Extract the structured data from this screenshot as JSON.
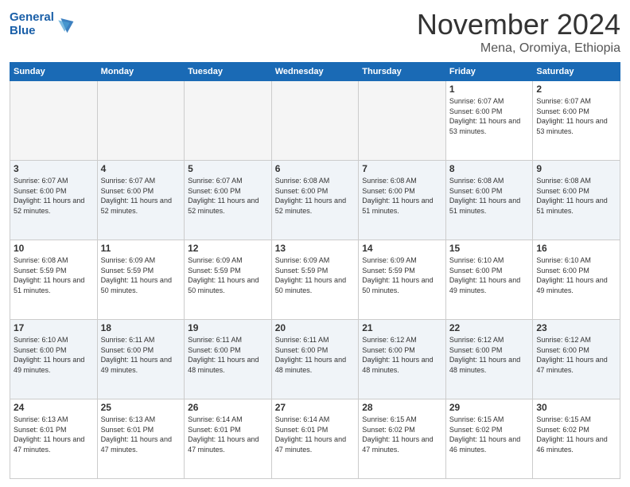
{
  "logo": {
    "line1": "General",
    "line2": "Blue"
  },
  "title": "November 2024",
  "location": "Mena, Oromiya, Ethiopia",
  "weekdays": [
    "Sunday",
    "Monday",
    "Tuesday",
    "Wednesday",
    "Thursday",
    "Friday",
    "Saturday"
  ],
  "weeks": [
    [
      {
        "day": "",
        "empty": true
      },
      {
        "day": "",
        "empty": true
      },
      {
        "day": "",
        "empty": true
      },
      {
        "day": "",
        "empty": true
      },
      {
        "day": "",
        "empty": true
      },
      {
        "day": "1",
        "sunrise": "6:07 AM",
        "sunset": "6:00 PM",
        "daylight": "11 hours and 53 minutes."
      },
      {
        "day": "2",
        "sunrise": "6:07 AM",
        "sunset": "6:00 PM",
        "daylight": "11 hours and 53 minutes."
      }
    ],
    [
      {
        "day": "3",
        "sunrise": "6:07 AM",
        "sunset": "6:00 PM",
        "daylight": "11 hours and 52 minutes."
      },
      {
        "day": "4",
        "sunrise": "6:07 AM",
        "sunset": "6:00 PM",
        "daylight": "11 hours and 52 minutes."
      },
      {
        "day": "5",
        "sunrise": "6:07 AM",
        "sunset": "6:00 PM",
        "daylight": "11 hours and 52 minutes."
      },
      {
        "day": "6",
        "sunrise": "6:08 AM",
        "sunset": "6:00 PM",
        "daylight": "11 hours and 52 minutes."
      },
      {
        "day": "7",
        "sunrise": "6:08 AM",
        "sunset": "6:00 PM",
        "daylight": "11 hours and 51 minutes."
      },
      {
        "day": "8",
        "sunrise": "6:08 AM",
        "sunset": "6:00 PM",
        "daylight": "11 hours and 51 minutes."
      },
      {
        "day": "9",
        "sunrise": "6:08 AM",
        "sunset": "6:00 PM",
        "daylight": "11 hours and 51 minutes."
      }
    ],
    [
      {
        "day": "10",
        "sunrise": "6:08 AM",
        "sunset": "5:59 PM",
        "daylight": "11 hours and 51 minutes."
      },
      {
        "day": "11",
        "sunrise": "6:09 AM",
        "sunset": "5:59 PM",
        "daylight": "11 hours and 50 minutes."
      },
      {
        "day": "12",
        "sunrise": "6:09 AM",
        "sunset": "5:59 PM",
        "daylight": "11 hours and 50 minutes."
      },
      {
        "day": "13",
        "sunrise": "6:09 AM",
        "sunset": "5:59 PM",
        "daylight": "11 hours and 50 minutes."
      },
      {
        "day": "14",
        "sunrise": "6:09 AM",
        "sunset": "5:59 PM",
        "daylight": "11 hours and 50 minutes."
      },
      {
        "day": "15",
        "sunrise": "6:10 AM",
        "sunset": "6:00 PM",
        "daylight": "11 hours and 49 minutes."
      },
      {
        "day": "16",
        "sunrise": "6:10 AM",
        "sunset": "6:00 PM",
        "daylight": "11 hours and 49 minutes."
      }
    ],
    [
      {
        "day": "17",
        "sunrise": "6:10 AM",
        "sunset": "6:00 PM",
        "daylight": "11 hours and 49 minutes."
      },
      {
        "day": "18",
        "sunrise": "6:11 AM",
        "sunset": "6:00 PM",
        "daylight": "11 hours and 49 minutes."
      },
      {
        "day": "19",
        "sunrise": "6:11 AM",
        "sunset": "6:00 PM",
        "daylight": "11 hours and 48 minutes."
      },
      {
        "day": "20",
        "sunrise": "6:11 AM",
        "sunset": "6:00 PM",
        "daylight": "11 hours and 48 minutes."
      },
      {
        "day": "21",
        "sunrise": "6:12 AM",
        "sunset": "6:00 PM",
        "daylight": "11 hours and 48 minutes."
      },
      {
        "day": "22",
        "sunrise": "6:12 AM",
        "sunset": "6:00 PM",
        "daylight": "11 hours and 48 minutes."
      },
      {
        "day": "23",
        "sunrise": "6:12 AM",
        "sunset": "6:00 PM",
        "daylight": "11 hours and 47 minutes."
      }
    ],
    [
      {
        "day": "24",
        "sunrise": "6:13 AM",
        "sunset": "6:01 PM",
        "daylight": "11 hours and 47 minutes."
      },
      {
        "day": "25",
        "sunrise": "6:13 AM",
        "sunset": "6:01 PM",
        "daylight": "11 hours and 47 minutes."
      },
      {
        "day": "26",
        "sunrise": "6:14 AM",
        "sunset": "6:01 PM",
        "daylight": "11 hours and 47 minutes."
      },
      {
        "day": "27",
        "sunrise": "6:14 AM",
        "sunset": "6:01 PM",
        "daylight": "11 hours and 47 minutes."
      },
      {
        "day": "28",
        "sunrise": "6:15 AM",
        "sunset": "6:02 PM",
        "daylight": "11 hours and 47 minutes."
      },
      {
        "day": "29",
        "sunrise": "6:15 AM",
        "sunset": "6:02 PM",
        "daylight": "11 hours and 46 minutes."
      },
      {
        "day": "30",
        "sunrise": "6:15 AM",
        "sunset": "6:02 PM",
        "daylight": "11 hours and 46 minutes."
      }
    ]
  ],
  "labels": {
    "sunrise": "Sunrise:",
    "sunset": "Sunset:",
    "daylight": "Daylight:"
  }
}
